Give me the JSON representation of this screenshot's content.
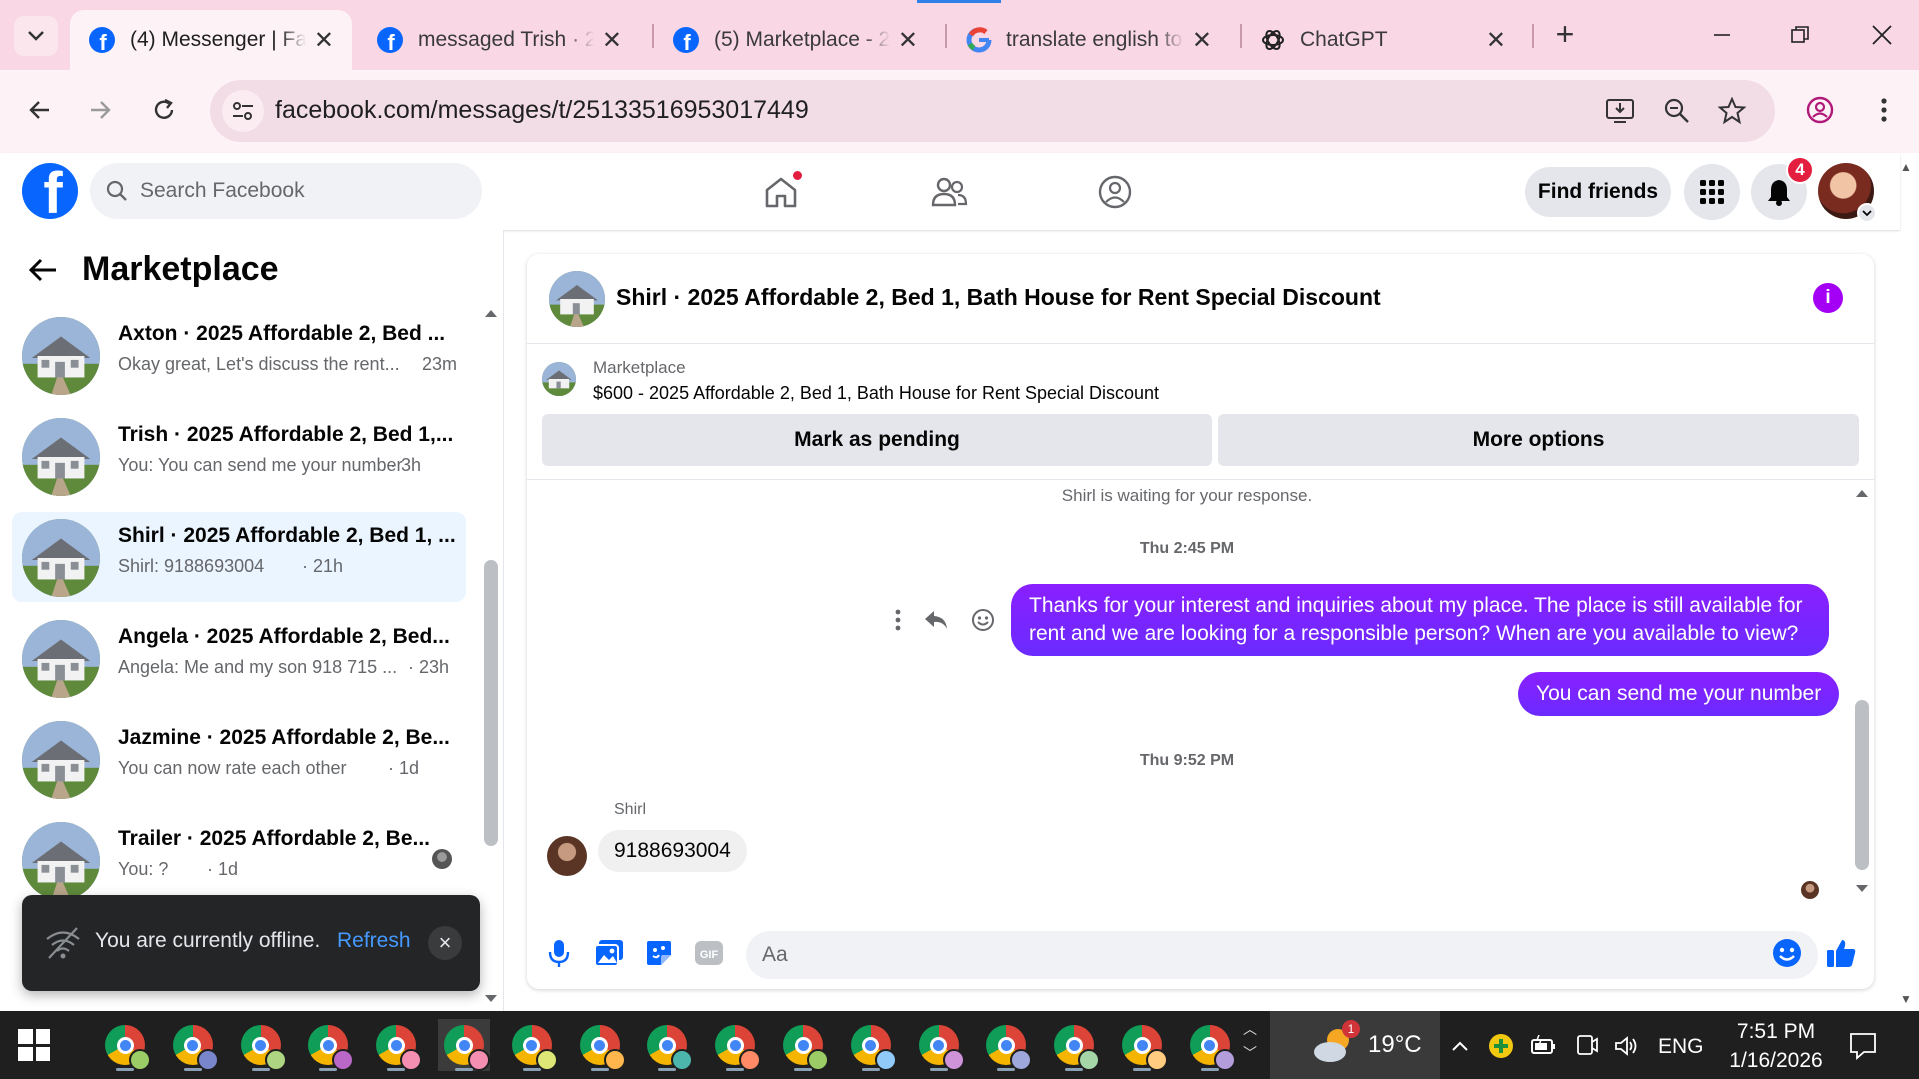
{
  "browser": {
    "tabs": [
      {
        "title": "(4) Messenger | Fa",
        "icon": "facebook-icon",
        "active": true
      },
      {
        "title": "messaged Trish · 2",
        "icon": "facebook-icon",
        "active": false
      },
      {
        "title": "(5) Marketplace - 2",
        "icon": "facebook-icon",
        "active": false
      },
      {
        "title": "translate english to",
        "icon": "google-icon",
        "active": false
      },
      {
        "title": "ChatGPT",
        "icon": "chatgpt-icon",
        "active": false
      }
    ],
    "url": "facebook.com/messages/t/25133516953017449"
  },
  "fb": {
    "logo_letter": "f",
    "search_placeholder": "Search Facebook",
    "find_friends_label": "Find friends",
    "notifications_count": "4",
    "brand_color": "#0866ff"
  },
  "sidebar": {
    "title": "Marketplace",
    "chats": [
      {
        "name": "Axton · 2025 Affordable 2, Bed ...",
        "preview": "Okay great, Let's discuss the rent...",
        "time": "23m",
        "active": false
      },
      {
        "name": "Trish · 2025 Affordable 2, Bed 1,...",
        "preview": "You: You can send me your number",
        "time": "· 3h",
        "active": false
      },
      {
        "name": "Shirl · 2025 Affordable 2, Bed 1, ...",
        "preview": "Shirl: 9188693004",
        "time": "· 21h",
        "active": true
      },
      {
        "name": "Angela · 2025 Affordable 2, Bed...",
        "preview": "Angela: Me and my son 918 715 ...",
        "time": "· 23h",
        "active": false
      },
      {
        "name": "Jazmine · 2025 Affordable 2, Be...",
        "preview": "You can now rate each other",
        "time": "· 1d",
        "active": false
      },
      {
        "name": "Trailer · 2025 Affordable 2, Be...",
        "preview": "You: ?",
        "time": "· 1d",
        "active": false
      }
    ],
    "offline_toast": {
      "message": "You are currently offline.",
      "action": "Refresh"
    }
  },
  "conversation": {
    "title": "Shirl · 2025 Affordable 2, Bed 1, Bath House for Rent Special Discount",
    "marketplace_label": "Marketplace",
    "listing": "$600 - 2025 Affordable 2, Bed 1, Bath House for Rent Special Discount",
    "mark_pending_label": "Mark as pending",
    "more_options_label": "More options",
    "waiting_note": "Shirl is waiting for your response.",
    "timestamp_1": "Thu 2:45 PM",
    "outgoing_1": "Thanks for your interest and inquiries about my place. The place is still available for rent and we are looking for a responsible person? When are you available to view?",
    "outgoing_2": "You can send me your number",
    "timestamp_2": "Thu 9:52 PM",
    "sender_name": "Shirl",
    "incoming_1": "9188693004",
    "input_placeholder": "Aa",
    "accent_color": "#7b1fff"
  },
  "taskbar": {
    "app_count": 17,
    "weather_temp": "19°C",
    "weather_badge": "1",
    "language": "ENG",
    "time": "7:51 PM",
    "date": "1/16/2026"
  }
}
